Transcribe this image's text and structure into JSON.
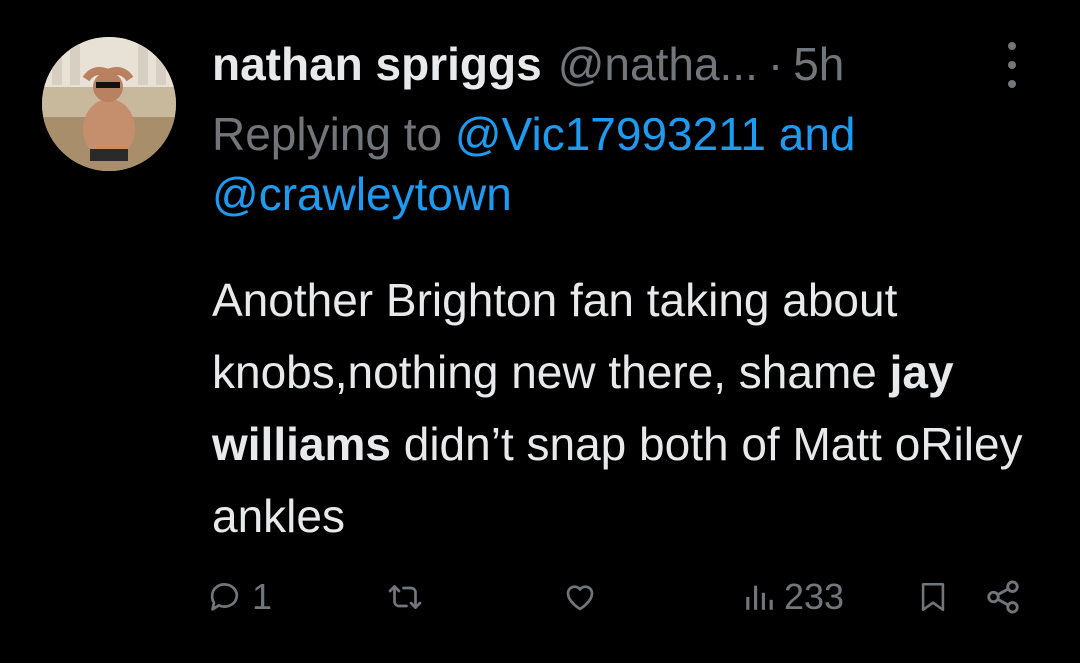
{
  "tweet": {
    "author_name": "nathan spriggs",
    "author_handle": "@natha...",
    "separator": "·",
    "time": "5h",
    "reply_prefix": "Replying to ",
    "reply_mention_1": "@Vic17993211",
    "reply_and": " and",
    "reply_mention_2": "@crawleytown",
    "text_part1": "Another Brighton fan taking about knobs,nothing new there, shame ",
    "text_bold": "jay williams",
    "text_part2": " didn’t snap both of Matt oRiley ankles"
  },
  "actions": {
    "reply_count": "1",
    "repost_count": "",
    "like_count": "",
    "views_count": "233"
  },
  "icons": {
    "reply": "reply-icon",
    "repost": "repost-icon",
    "like": "heart-icon",
    "views": "views-icon",
    "bookmark": "bookmark-icon",
    "share": "share-icon",
    "more": "more-icon"
  },
  "colors": {
    "background": "#000000",
    "text": "#e7e9ea",
    "secondary": "#71767b",
    "mention": "#1d9bf0"
  }
}
